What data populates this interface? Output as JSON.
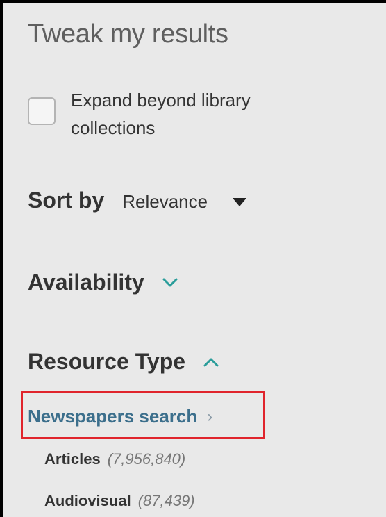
{
  "panel": {
    "title": "Tweak my results",
    "expand": {
      "label": "Expand beyond library collections",
      "checked": false
    },
    "sort": {
      "label": "Sort by",
      "selected": "Relevance"
    },
    "availability": {
      "label": "Availability",
      "expanded": false
    },
    "resource_type": {
      "label": "Resource Type",
      "expanded": true,
      "newspapers_link": "Newspapers search",
      "items": [
        {
          "name": "Articles",
          "count": "(7,956,840)"
        },
        {
          "name": "Audiovisual",
          "count": "(87,439)"
        }
      ]
    }
  },
  "colors": {
    "panel_bg": "#e9e9e9",
    "accent": "#2a9d9a",
    "link": "#3c6f8c",
    "highlight_box": "#e0242c"
  },
  "icons": {
    "sort_dropdown": "triangle-down-icon",
    "availability_toggle": "chevron-down-icon",
    "resource_type_toggle": "chevron-up-icon",
    "newspapers_chevron": "chevron-right-icon"
  }
}
